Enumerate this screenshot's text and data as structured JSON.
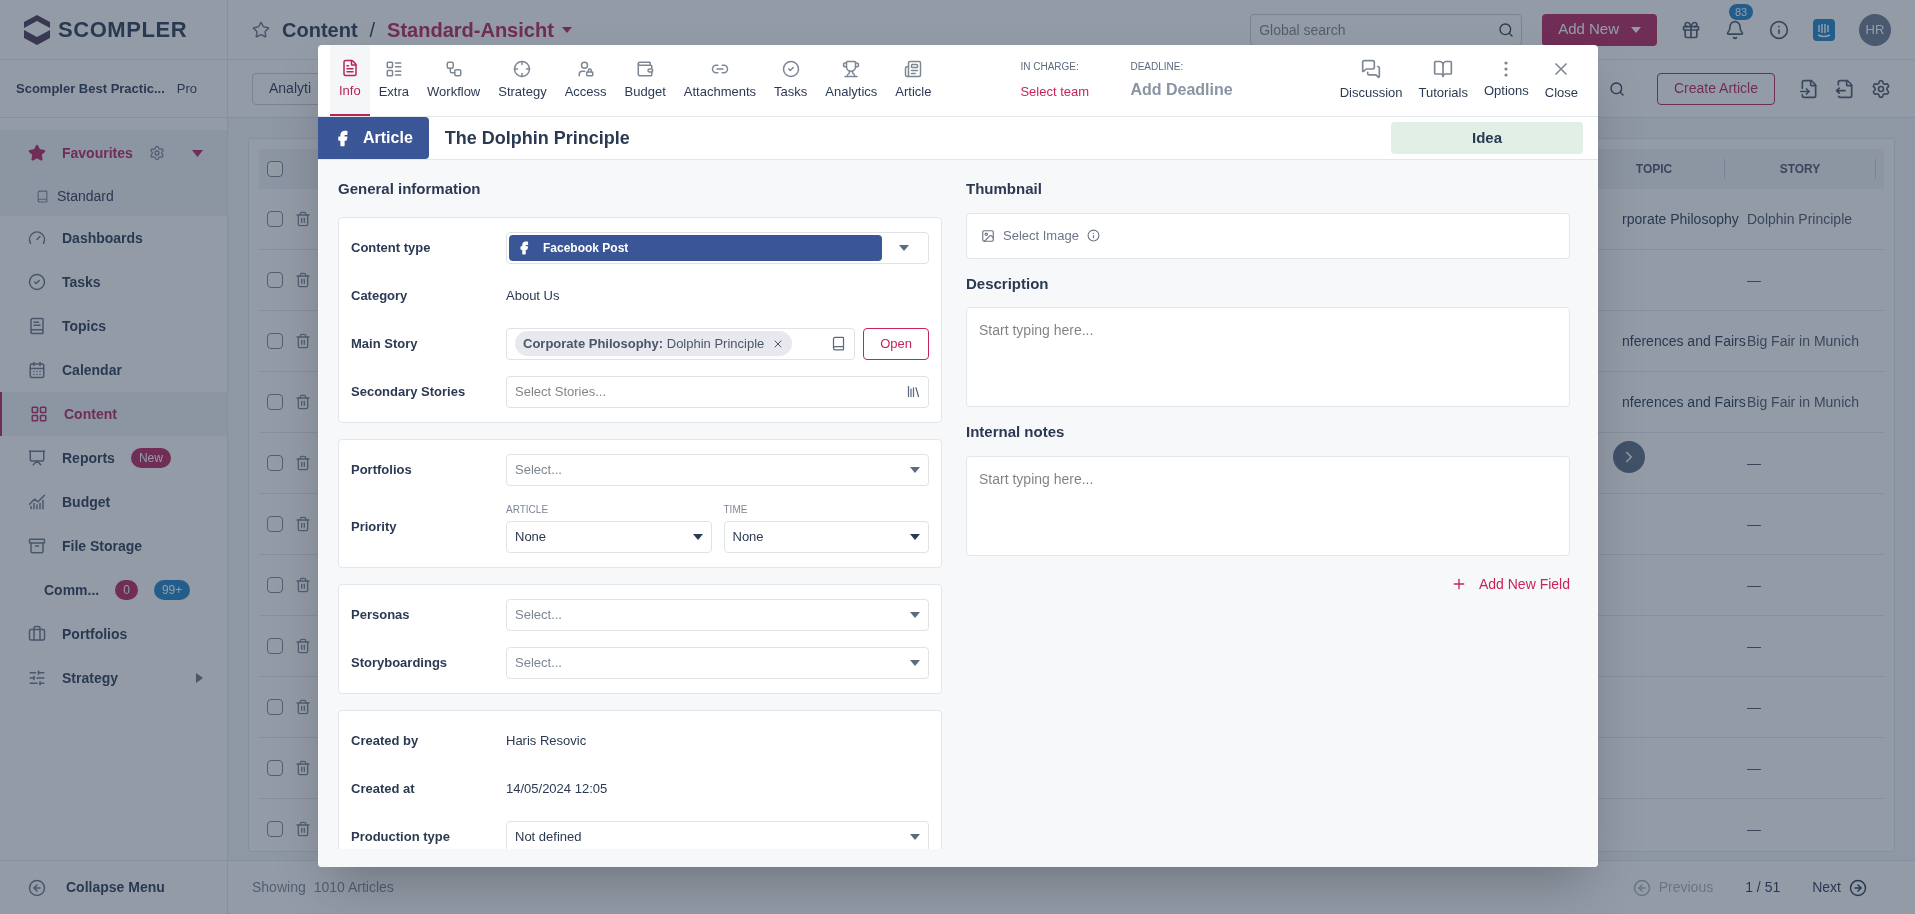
{
  "brand": {
    "logo": "SCOMPLER",
    "workspace": "Scompler Best Practic...",
    "plan": "Pro"
  },
  "favourites": {
    "label": "Favourites",
    "expanded": true,
    "items": [
      {
        "label": "Standard"
      }
    ]
  },
  "sidebar": {
    "items": [
      {
        "label": "Dashboards",
        "selected": false,
        "submenu": false
      },
      {
        "label": "Tasks",
        "selected": false,
        "submenu": false
      },
      {
        "label": "Topics",
        "selected": false,
        "submenu": false
      },
      {
        "label": "Calendar",
        "selected": false,
        "submenu": false
      },
      {
        "label": "Content",
        "selected": true,
        "submenu": false
      },
      {
        "label": "Reports",
        "selected": false,
        "submenu": false,
        "badges": [
          {
            "text": "New",
            "kind": "alert"
          }
        ]
      },
      {
        "label": "Budget",
        "selected": false,
        "submenu": false
      },
      {
        "label": "File Storage",
        "selected": false,
        "submenu": false
      },
      {
        "label": "Comm...",
        "selected": false,
        "submenu": true,
        "badges": [
          {
            "text": "0",
            "kind": "alert"
          },
          {
            "text": "99+",
            "kind": "info"
          }
        ]
      },
      {
        "label": "Portfolios",
        "selected": false,
        "submenu": false
      },
      {
        "label": "Strategy",
        "selected": false,
        "submenu": true
      }
    ],
    "collapse": "Collapse Menu"
  },
  "header": {
    "section": "Content",
    "separator": "/",
    "view": "Standard-Ansicht",
    "search_placeholder": "Global search",
    "add_new": "Add New",
    "notifications": "83",
    "avatar": "HR"
  },
  "toolbar": {
    "view_button": "Analyti",
    "create_button": "Create Article"
  },
  "table": {
    "all_checked": false,
    "columns": [
      "TOPIC",
      "STORY"
    ],
    "rows": [
      {
        "checked": false,
        "topic": "rporate Philosophy",
        "story": "Dolphin Principle"
      },
      {
        "checked": false,
        "story": "—"
      },
      {
        "checked": false,
        "topic": "nferences and Fairs",
        "story": "Big Fair in Munich"
      },
      {
        "checked": false,
        "topic": "nferences and Fairs",
        "story": "Big Fair in Munich"
      },
      {
        "checked": false,
        "story": "—"
      },
      {
        "checked": false,
        "story": "—"
      },
      {
        "checked": false,
        "story": "—"
      },
      {
        "checked": false,
        "story": "—"
      },
      {
        "checked": false,
        "story": "—"
      },
      {
        "checked": false,
        "story": "—"
      },
      {
        "checked": false,
        "story": "—"
      }
    ]
  },
  "footer": {
    "showing": "Showing",
    "count": "1010 Articles",
    "previous": {
      "label": "Previous",
      "disabled": true
    },
    "page": "1 / 51",
    "next": {
      "label": "Next",
      "disabled": false
    }
  },
  "modal": {
    "tabs": [
      {
        "label": "Info",
        "selected": true
      },
      {
        "label": "Extra",
        "selected": false
      },
      {
        "label": "Workflow",
        "selected": false
      },
      {
        "label": "Strategy",
        "selected": false
      },
      {
        "label": "Access",
        "selected": false
      },
      {
        "label": "Budget",
        "selected": false
      },
      {
        "label": "Attachments",
        "selected": false
      },
      {
        "label": "Tasks",
        "selected": false
      },
      {
        "label": "Analytics",
        "selected": false
      },
      {
        "label": "Article",
        "selected": false
      }
    ],
    "in_charge": {
      "label": "IN CHARGE:",
      "value": "Select team"
    },
    "deadline": {
      "label": "DEADLINE:",
      "value": "Add Deadline"
    },
    "actions": [
      "Discussion",
      "Tutorials",
      "Options",
      "Close"
    ],
    "type_badge": "Article",
    "title": "The Dolphin Principle",
    "status": "Idea",
    "left_heading": "General information",
    "sections": [
      [
        {
          "kind": "brand_select",
          "label": "Content type",
          "value": "Facebook Post"
        },
        {
          "kind": "text",
          "label": "Category",
          "value": "About Us"
        },
        {
          "kind": "story",
          "label": "Main Story",
          "chip_topic": "Corporate Philosophy:",
          "chip_story": "Dolphin Principle",
          "button": "Open"
        },
        {
          "kind": "stories_input",
          "label": "Secondary Stories",
          "placeholder": "Select Stories..."
        }
      ],
      [
        {
          "kind": "select",
          "label": "Portfolios",
          "placeholder": "Select..."
        },
        {
          "kind": "priority",
          "label": "Priority",
          "selects": [
            {
              "label": "ARTICLE",
              "value": "None"
            },
            {
              "label": "TIME",
              "value": "None"
            }
          ]
        }
      ],
      [
        {
          "kind": "select",
          "label": "Personas",
          "placeholder": "Select..."
        },
        {
          "kind": "select",
          "label": "Storyboardings",
          "placeholder": "Select..."
        }
      ],
      [
        {
          "kind": "text",
          "label": "Created by",
          "value": "Haris Resovic"
        },
        {
          "kind": "text",
          "label": "Created at",
          "value": "14/05/2024 12:05"
        },
        {
          "kind": "select",
          "label": "Production type",
          "value": "Not defined"
        }
      ]
    ],
    "thumbnail": {
      "heading": "Thumbnail",
      "action": "Select Image"
    },
    "description": {
      "heading": "Description",
      "placeholder": "Start typing here..."
    },
    "notes": {
      "heading": "Internal notes",
      "placeholder": "Start typing here..."
    },
    "add_field": "Add New Field"
  }
}
